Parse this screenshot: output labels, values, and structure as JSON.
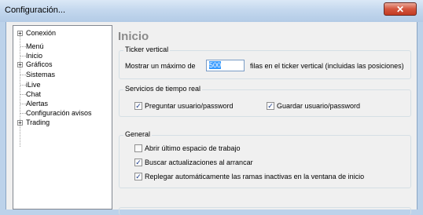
{
  "window": {
    "title": "Configuración...",
    "close_glyph": "✕"
  },
  "tree": {
    "items": [
      {
        "label": "Conexión",
        "expandable": true
      },
      {
        "label": "Menú",
        "expandable": false
      },
      {
        "label": "Inicio",
        "expandable": false
      },
      {
        "label": "Gráficos",
        "expandable": true
      },
      {
        "label": "Sistemas",
        "expandable": false
      },
      {
        "label": "iLive",
        "expandable": false
      },
      {
        "label": "Chat",
        "expandable": false
      },
      {
        "label": "Alertas",
        "expandable": false
      },
      {
        "label": "Configuración avisos",
        "expandable": false
      },
      {
        "label": "Trading",
        "expandable": true
      }
    ]
  },
  "page": {
    "title": "Inicio"
  },
  "ticker": {
    "group_label": "Ticker vertical",
    "prefix": "Mostrar un máximo de",
    "value": "500",
    "suffix": "filas en el ticker vertical (incluidas las posiciones)"
  },
  "realtime": {
    "group_label": "Servicios de tiempo real",
    "ask_user": {
      "label": "Preguntar usuario/password",
      "checked": true
    },
    "save_user": {
      "label": "Guardar usuario/password",
      "checked": true
    }
  },
  "general": {
    "group_label": "General",
    "open_workspace": {
      "label": "Abrir último espacio de trabajo",
      "checked": false
    },
    "check_updates": {
      "label": "Buscar actualizaciones al arrancar",
      "checked": true
    },
    "collapse_branches": {
      "label": "Replegar automáticamente las ramas inactivas en la ventana de inicio",
      "checked": true
    }
  },
  "check_glyph": "✓",
  "expander_glyph": "+"
}
